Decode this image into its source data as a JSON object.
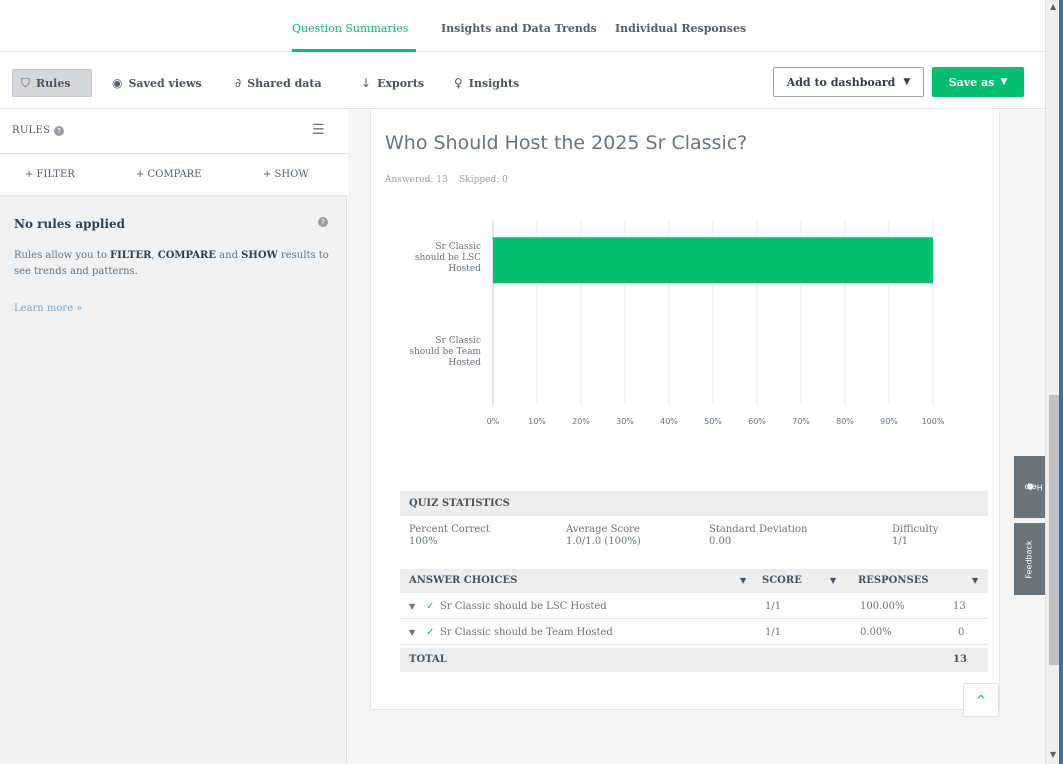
{
  "tabs": [
    {
      "label": "Question Summaries",
      "active": true
    },
    {
      "label": "Insights and Data Trends",
      "active": false
    },
    {
      "label": "Individual Responses",
      "active": false
    }
  ],
  "toolbar": {
    "rules": "Rules",
    "saved_views": "Saved views",
    "shared_data": "Shared data",
    "exports": "Exports",
    "insights": "Insights",
    "add_to_dashboard": "Add to dashboard",
    "save_as": "Save as"
  },
  "icons": {
    "rules": "filter-icon",
    "saved_views": "eye-icon",
    "shared_data": "link-icon",
    "exports": "download-arrow-icon",
    "insights": "lightbulb-icon"
  },
  "rules_panel": {
    "title": "RULES",
    "actions": [
      "+ FILTER",
      "+ COMPARE",
      "+ SHOW"
    ],
    "empty_title": "No rules applied",
    "desc_prefix": "Rules allow you to ",
    "filter": "FILTER",
    "sep1": ", ",
    "compare": "COMPARE",
    "sep2": " and ",
    "show": "SHOW",
    "desc_suffix": " results to see trends and patterns.",
    "learn_more": "Learn more »"
  },
  "question": {
    "title": "Who Should Host the 2025 Sr Classic?",
    "meta": "Answered: 13    Skipped: 0"
  },
  "chart_data": {
    "type": "bar",
    "orientation": "horizontal",
    "categories": [
      "Sr Classic should be LSC Hosted",
      "Sr Classic should be Team Hosted"
    ],
    "category_lines": [
      [
        "Sr Classic",
        "should be LSC",
        "Hosted"
      ],
      [
        "Sr Classic",
        "should be Team",
        "Hosted"
      ]
    ],
    "values": [
      100,
      0
    ],
    "xlim": [
      0,
      100
    ],
    "xticks": [
      "0%",
      "10%",
      "20%",
      "30%",
      "40%",
      "50%",
      "60%",
      "70%",
      "80%",
      "90%",
      "100%"
    ],
    "grid": true,
    "color": "#00bf6f"
  },
  "quiz": {
    "header": "QUIZ STATISTICS",
    "stats": [
      {
        "label": "Percent Correct",
        "value": "100%"
      },
      {
        "label": "Average Score",
        "value": "1.0/1.0 (100%)"
      },
      {
        "label": "Standard Deviation",
        "value": "0.00"
      },
      {
        "label": "Difficulty",
        "value": "1/1"
      }
    ]
  },
  "answers": {
    "headers": {
      "choices": "ANSWER CHOICES",
      "score": "SCORE",
      "responses": "RESPONSES"
    },
    "rows": [
      {
        "label": "Sr Classic should be LSC Hosted",
        "score": "1/1",
        "pct": "100.00%",
        "count": "13"
      },
      {
        "label": "Sr Classic should be Team Hosted",
        "score": "1/1",
        "pct": "0.00%",
        "count": "0"
      }
    ],
    "total_label": "TOTAL",
    "total_count": "13"
  },
  "side_tabs": {
    "help": "Help",
    "feedback": "Feedback"
  }
}
